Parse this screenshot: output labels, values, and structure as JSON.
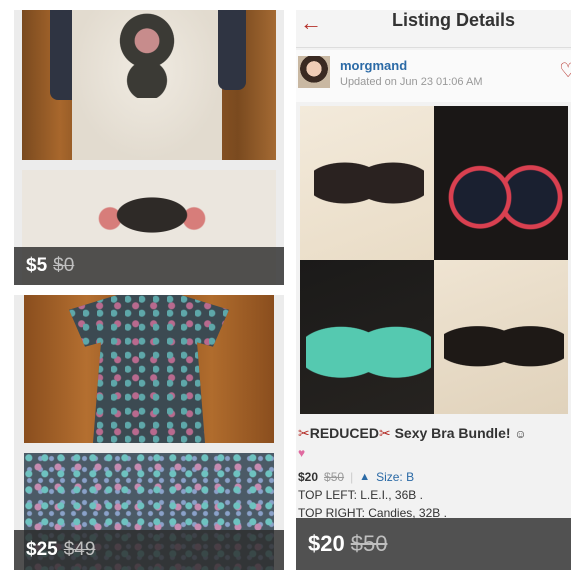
{
  "tiles": [
    {
      "price": "$5",
      "original_price": "$0"
    },
    {
      "price": "$25",
      "original_price": "$49"
    },
    {
      "header": {
        "back_icon": "back-arrow-icon",
        "title": "Listing Details"
      },
      "user": {
        "name": "morgmand",
        "updated": "Updated on Jun 23 01:06 AM"
      },
      "listing": {
        "title_prefix": "REDUCED",
        "title_main": "Sexy Bra Bundle!",
        "price": "$20",
        "original_price": "$50",
        "size_label": "Size: B",
        "line1": "TOP LEFT: L.E.I., 36B .",
        "line2": "TOP RIGHT: Candies, 32B ."
      },
      "price": "$20",
      "original_price": "$50"
    }
  ],
  "colors": {
    "accent_red": "#b5302a",
    "link_blue": "#2b6aa6",
    "price_bar": "#2d2d2d"
  }
}
